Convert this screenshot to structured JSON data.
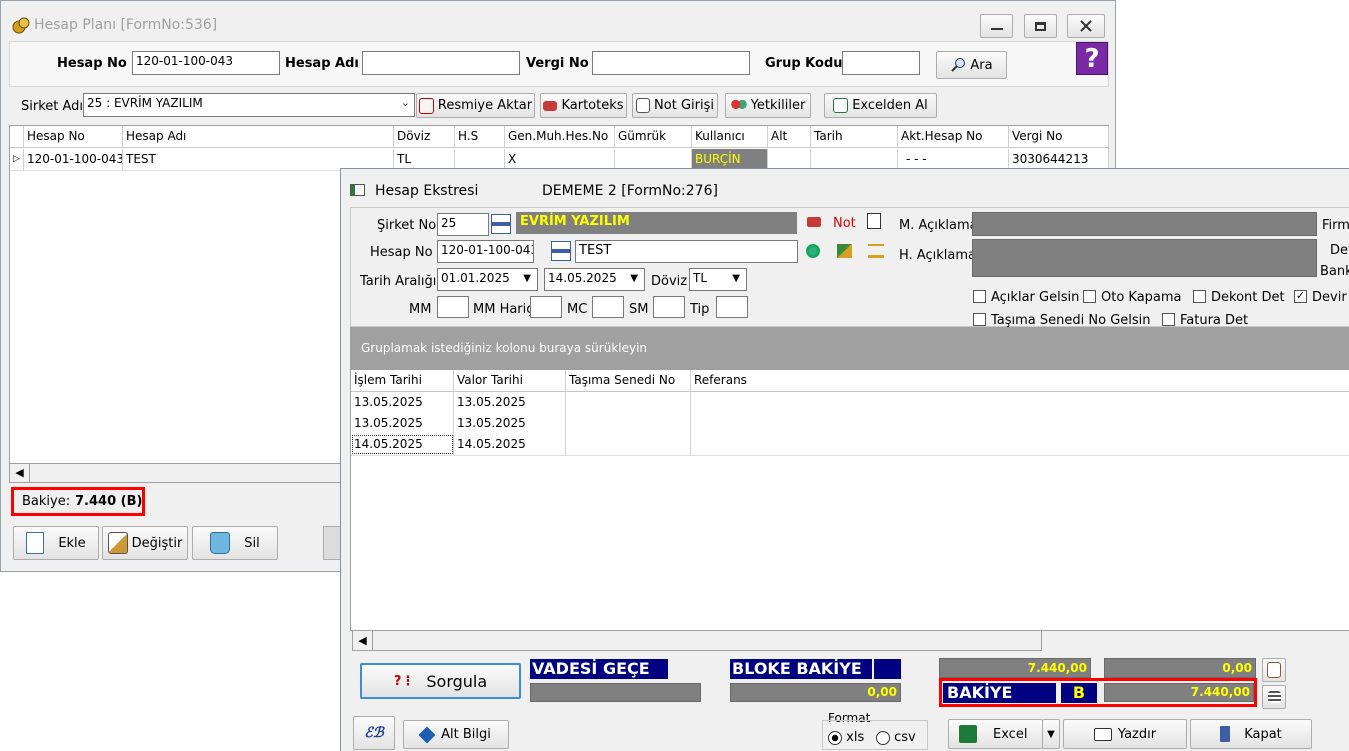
{
  "main_window": {
    "title": "Hesap Planı [FormNo:536]",
    "help_glyph": "?",
    "search": {
      "hesap_no_label": "Hesap No",
      "hesap_no_value": "120-01-100-043",
      "hesap_adi_label": "Hesap Adı",
      "hesap_adi_value": "",
      "vergi_no_label": "Vergi No",
      "vergi_no_value": "",
      "grup_kodu_label": "Grup Kodu",
      "grup_kodu_value": "",
      "ara_label": "Ara"
    },
    "sirket_label": "Sirket Adı",
    "sirket_value": "25 : EVRİM YAZILIM",
    "toolbar": {
      "resmiye": "Resmiye Aktar",
      "kartoteks": "Kartoteks",
      "not_girisi": "Not Girişi",
      "yetkililer": "Yetkililer",
      "excelden": "Excelden Al"
    },
    "grid": {
      "columns": [
        "Hesap No",
        "Hesap Adı",
        "Döviz",
        "H.S",
        "Gen.Muh.Hes.No",
        "Gümrük",
        "Kullanıcı",
        "Alt",
        "Tarih",
        "Akt.Hesap No",
        "Vergi No"
      ],
      "row": {
        "hesap_no": "120-01-100-043",
        "hesap_adi": "TEST",
        "doviz": "TL",
        "hs": "",
        "gen_muh": "X",
        "gumruk": "",
        "kullanici": "BURÇİN",
        "alt": "",
        "tarih": "",
        "akt_hesap": "- - -",
        "vergi_no": "3030644213"
      }
    },
    "bakiye_label": "Bakiye:",
    "bakiye_value": "7.440 (B)",
    "buttons": {
      "ekle": "Ekle",
      "degistir": "Değiştir",
      "sil": "Sil"
    }
  },
  "ekstre_window": {
    "title": "Hesap Ekstresi",
    "subtitle": "DEMEME 2 [FormNo:276]",
    "sirket_no_label": "Şirket No",
    "sirket_no_value": "25",
    "sirket_name": "EVRİM YAZILIM",
    "not_label": "Not",
    "hesap_no_label": "Hesap No",
    "hesap_no_value": "120-01-100-043",
    "hesap_name": "TEST",
    "tarih_label": "Tarih Aralığı",
    "tarih_start": "01.01.2025",
    "tarih_end": "14.05.2025",
    "doviz_label": "Döviz",
    "doviz_value": "TL",
    "mm_label": "MM",
    "mm_haric_label": "MM Hariç",
    "mc_label": "MC",
    "sm_label": "SM",
    "tip_label": "Tip",
    "m_aciklama_label": "M. Açıklama",
    "h_aciklama_label": "H. Açıklama",
    "firma_label": "Firm",
    "dev_label": "Dev",
    "bank_label": "Bank",
    "checks": {
      "aciklar": "Açıklar Gelsin",
      "oto_kapama": "Oto Kapama",
      "dekont_det": "Dekont Det",
      "devir": "Devir G",
      "tasima": "Taşıma Senedi No Gelsin",
      "fatura_det": "Fatura Det"
    },
    "group_hint": "Gruplamak istediğiniz kolonu buraya sürükleyin",
    "grid": {
      "columns": [
        "İşlem Tarihi",
        "Valor Tarihi",
        "Taşıma Senedi No",
        "Referans"
      ],
      "rows": [
        [
          "13.05.2025",
          "13.05.2025",
          "",
          ""
        ],
        [
          "13.05.2025",
          "13.05.2025",
          "",
          ""
        ],
        [
          "14.05.2025",
          "14.05.2025",
          "",
          ""
        ]
      ]
    },
    "sorgula": "Sorgula",
    "vadesi_gecen": "VADESİ GEÇE",
    "bloke_bakiye": "BLOKE BAKİYE",
    "bloke_value": "0,00",
    "total1": "7.440,00",
    "total2": "0,00",
    "bakiye_label": "BAKİYE",
    "bakiye_type": "B",
    "bakiye_value": "7.440,00",
    "alt_bilgi": "Alt Bilgi",
    "format_label": "Format",
    "format_xls": "xls",
    "format_csv": "csv",
    "excel": "Excel",
    "yazdir": "Yazdır",
    "kapat": "Kapat"
  }
}
